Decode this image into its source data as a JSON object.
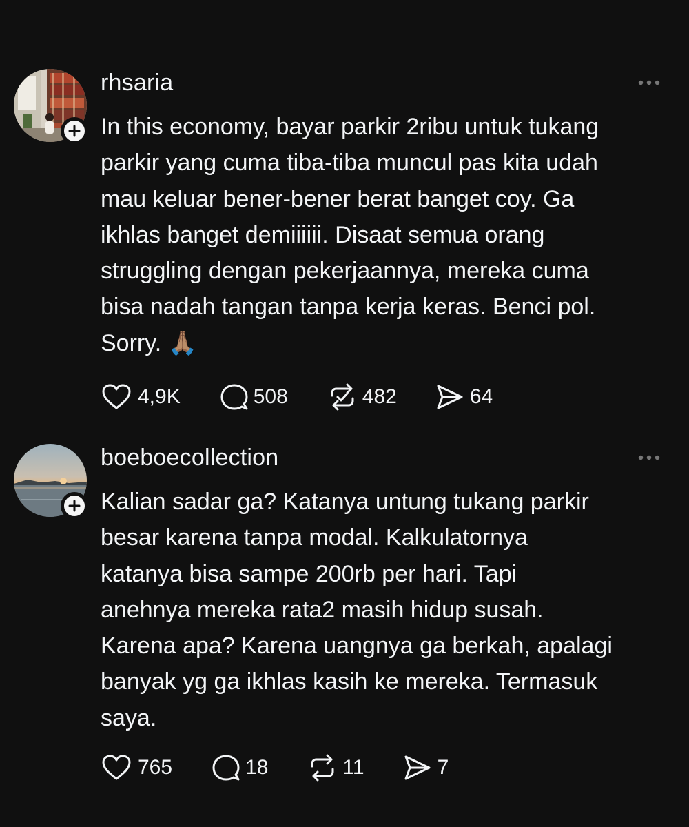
{
  "posts": [
    {
      "username": "rhsaria",
      "text": "In this economy, bayar parkir 2ribu untuk tukang\nparkir yang cuma tiba-tiba muncul pas kita udah\nmau keluar bener-bener berat banget coy. Ga\nikhlas banget demiiiiii. Disaat semua orang\nstruggling dengan pekerjaannya, mereka cuma\nbisa nadah tangan tanpa kerja keras. Benci pol.\nSorry. 🙏🏽",
      "likes": "4,9K",
      "replies": "508",
      "reposts": "482",
      "shares": "64",
      "avatar_icon": "bookshelf-room-photo"
    },
    {
      "username": "boeboecollection",
      "text": "Kalian sadar ga? Katanya untung tukang parkir\nbesar karena tanpa modal. Kalkulatornya\nkatanya bisa sampe 200rb per hari. Tapi\nanehnya mereka rata2 masih hidup susah.\nKarena apa? Karena uangnya ga berkah, apalagi\nbanyak yg ga ikhlas kasih ke mereka. Termasuk\nsaya.",
      "likes": "765",
      "replies": "18",
      "reposts": "11",
      "shares": "7",
      "avatar_icon": "sunset-sea-photo"
    }
  ],
  "icons": {
    "like": "heart-icon",
    "reply": "comment-icon",
    "repost": "repost-icon",
    "share": "send-icon",
    "more": "more-icon",
    "follow": "plus-icon"
  },
  "colors": {
    "background": "#101010",
    "text": "#f3f5f7",
    "muted": "#777777"
  }
}
